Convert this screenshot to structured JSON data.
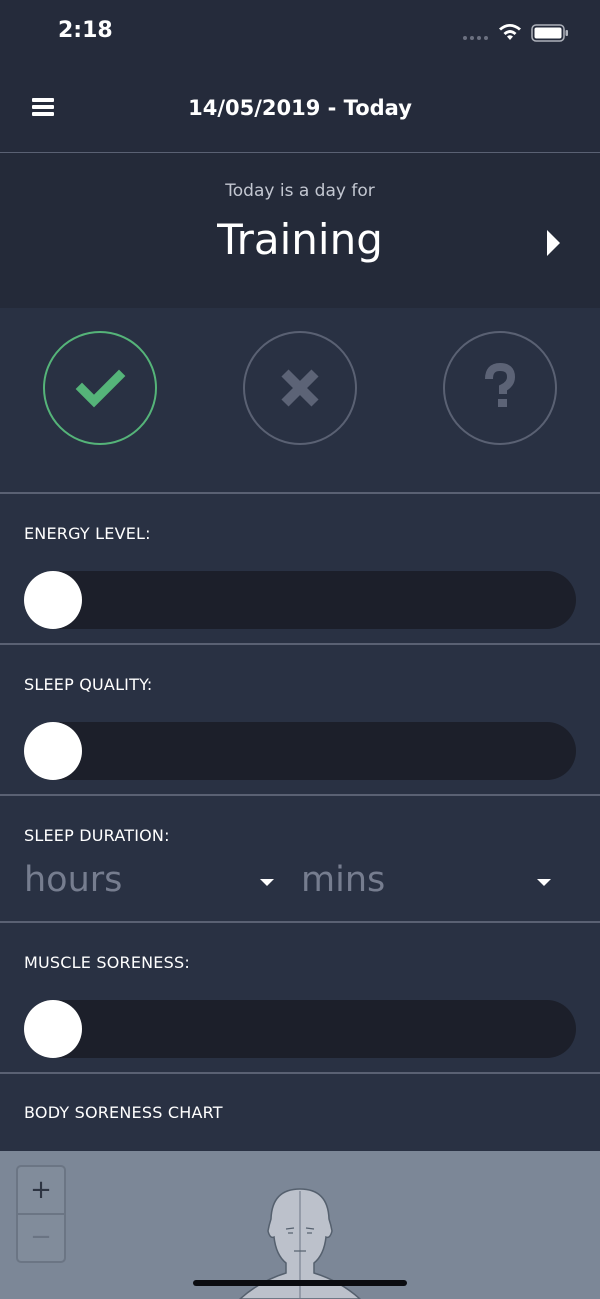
{
  "status_bar": {
    "time": "2:18",
    "icons": [
      "signal-dots-icon",
      "wifi-icon",
      "battery-icon"
    ]
  },
  "header": {
    "title": "14/05/2019 - Today",
    "menu_icon": "menu-icon"
  },
  "day_for": {
    "subtitle": "Today is a day for",
    "value": "Training",
    "next_icon": "chevron-right-icon"
  },
  "choices": [
    {
      "name": "yes",
      "icon": "check-icon",
      "selected": true,
      "color": "#55b479"
    },
    {
      "name": "no",
      "icon": "cross-icon",
      "selected": false
    },
    {
      "name": "unsure",
      "icon": "question-icon",
      "selected": false
    }
  ],
  "energy": {
    "label": "ENERGY LEVEL:",
    "value": 0
  },
  "sleep_quality": {
    "label": "SLEEP QUALITY:",
    "value": 0
  },
  "sleep_duration": {
    "label": "SLEEP DURATION:",
    "hours_placeholder": "hours",
    "mins_placeholder": "mins"
  },
  "muscle_soreness": {
    "label": "MUSCLE SORENESS:",
    "value": 0
  },
  "body_chart": {
    "label": "BODY SORENESS CHART",
    "zoom_in": "+",
    "zoom_out": "−"
  },
  "colors": {
    "background": "#252b3b",
    "panel": "#293143",
    "accent": "#55b479",
    "track": "#1c1f2a",
    "chart_bg": "#7c8797"
  }
}
